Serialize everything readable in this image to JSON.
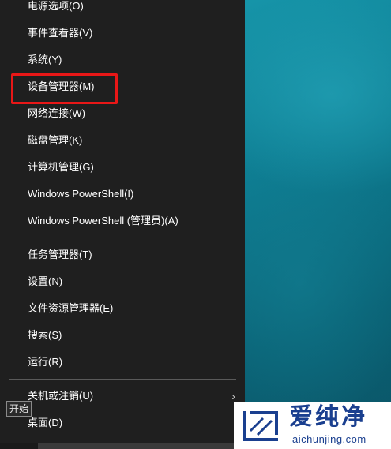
{
  "menu": {
    "items": [
      {
        "label": "电源选项(O)"
      },
      {
        "label": "事件查看器(V)"
      },
      {
        "label": "系统(Y)"
      },
      {
        "label": "设备管理器(M)"
      },
      {
        "label": "网络连接(W)"
      },
      {
        "label": "磁盘管理(K)"
      },
      {
        "label": "计算机管理(G)"
      },
      {
        "label": "Windows PowerShell(I)"
      },
      {
        "label": "Windows PowerShell (管理员)(A)"
      },
      {
        "label": "任务管理器(T)"
      },
      {
        "label": "设置(N)"
      },
      {
        "label": "文件资源管理器(E)"
      },
      {
        "label": "搜索(S)"
      },
      {
        "label": "运行(R)"
      },
      {
        "label": "关机或注销(U)",
        "submenu_arrow": "›"
      },
      {
        "label": "桌面(D)"
      }
    ],
    "highlighted_item": "设备管理器(M)",
    "highlight_color": "#e81717"
  },
  "tooltip": {
    "text": "开始"
  },
  "watermark": {
    "name": "爱纯净",
    "url": "aichunjing.com",
    "color": "#1a3f8f"
  },
  "colors": {
    "menu_background": "#1f1f1f",
    "menu_text": "#ffffff",
    "separator": "#5a5a5a",
    "desktop": "#0d6e82"
  }
}
